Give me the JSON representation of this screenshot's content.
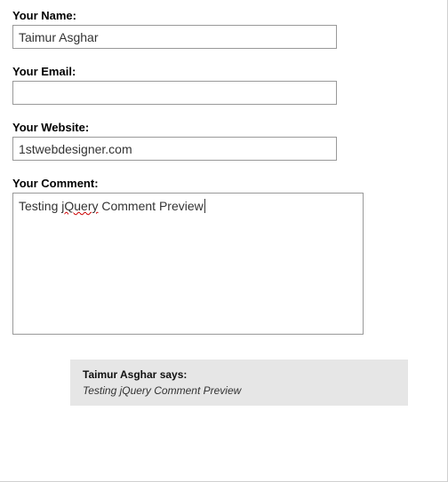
{
  "form": {
    "name": {
      "label": "Your Name:",
      "value": "Taimur Asghar"
    },
    "email": {
      "label": "Your Email:",
      "value": ""
    },
    "website": {
      "label": "Your Website:",
      "value": "1stwebdesigner.com"
    },
    "comment": {
      "label": "Your Comment:",
      "value_pre": "Testing ",
      "value_misspelled": "jQuery",
      "value_post": " Comment Preview "
    }
  },
  "preview": {
    "author_name": "Taimur Asghar",
    "says": " says:",
    "comment_text": "Testing jQuery Comment Preview"
  }
}
